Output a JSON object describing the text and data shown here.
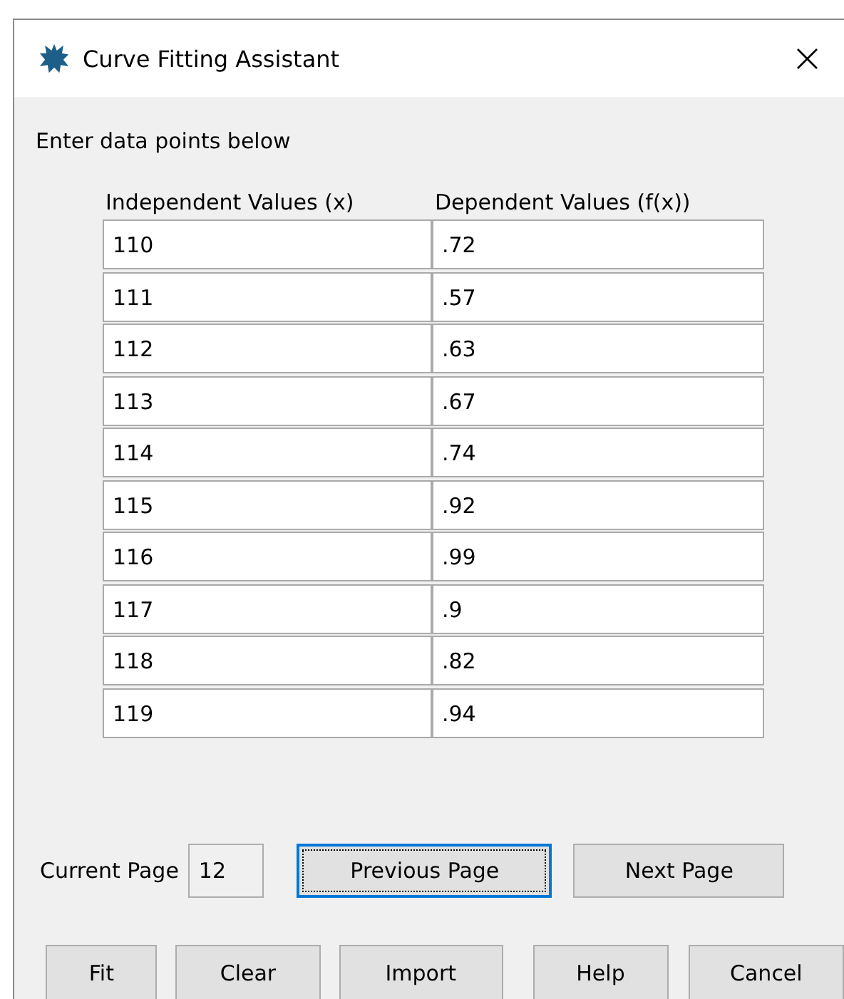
{
  "window": {
    "title": "Curve Fitting Assistant",
    "close": "×"
  },
  "instruction": "Enter data points below",
  "table": {
    "columns": [
      "Independent Values (x)",
      "Dependent Values (f(x))"
    ],
    "rows": [
      [
        "110",
        ".72"
      ],
      [
        "111",
        ".57"
      ],
      [
        "112",
        ".63"
      ],
      [
        "113",
        ".67"
      ],
      [
        "114",
        ".74"
      ],
      [
        "115",
        ".92"
      ],
      [
        "116",
        ".99"
      ],
      [
        "117",
        ".9"
      ],
      [
        "118",
        ".82"
      ],
      [
        "119",
        ".94"
      ]
    ]
  },
  "pager": {
    "label": "Current Page",
    "page": "12",
    "buttons": [
      {
        "label": "Previous Page",
        "focused": true
      },
      {
        "label": "Next Page",
        "focused": false
      }
    ]
  },
  "buttons": [
    {
      "label": "Fit",
      "focused": false
    },
    {
      "label": "Clear",
      "focused": false
    },
    {
      "label": "Import",
      "focused": false
    },
    {
      "label": "Help",
      "focused": false
    },
    {
      "label": "Cancel",
      "focused": false
    }
  ]
}
